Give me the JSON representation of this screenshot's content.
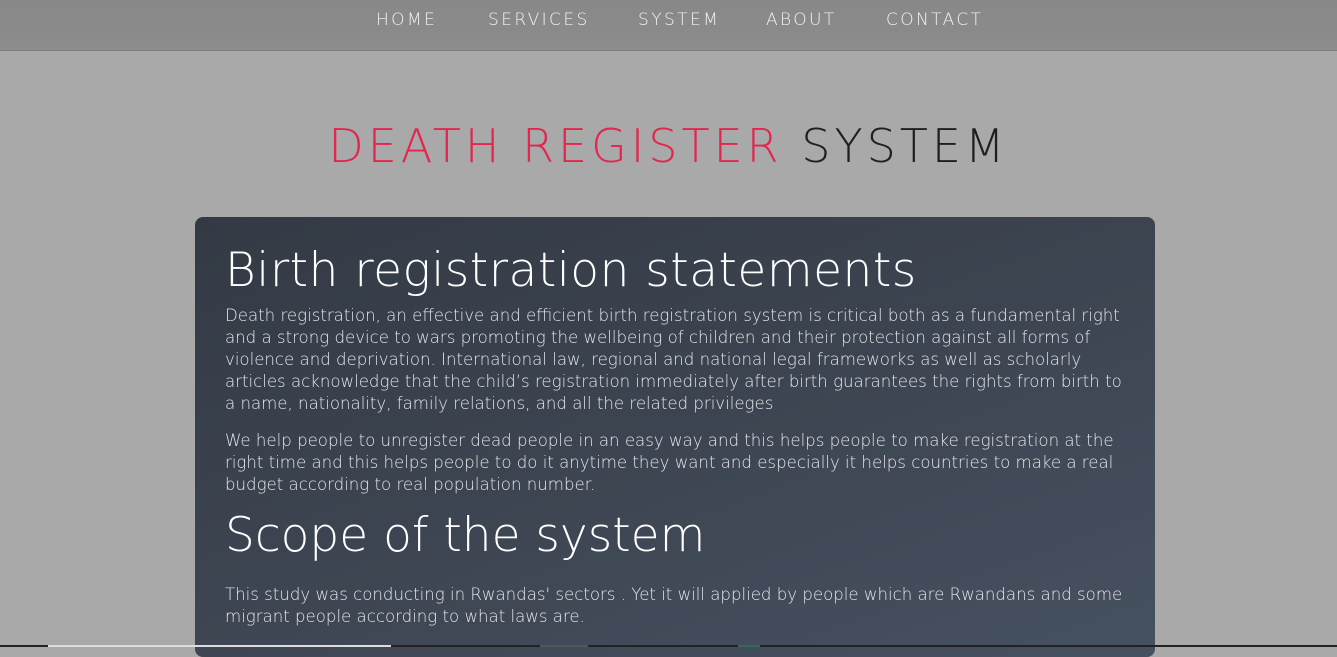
{
  "nav": {
    "items": [
      {
        "label": "HOME"
      },
      {
        "label": "SERVICES"
      },
      {
        "label": "SYSTEM"
      },
      {
        "label": "ABOUT"
      },
      {
        "label": "CONTACT"
      }
    ]
  },
  "header": {
    "title_part1": "DEATH REGISTER",
    "title_part2": "SYSTEM"
  },
  "main": {
    "heading1": "Birth registration statements",
    "paragraph1": "Death registration, an effective and efficient birth registration system is critical both as a fundamental right and a strong device to wars promoting the wellbeing of children and their protection against all forms of violence and deprivation. International law, regional and national legal frameworks as well as scholarly articles acknowledge that the child’s registration immediately after birth guarantees the rights from birth to a name, nationality, family relations, and all the related privileges",
    "paragraph2": "We help people to unregister dead people in an easy way and this helps people to make registration at the right time and this helps people to do it anytime they want and especially it helps countries to make a real budget according to real population number.",
    "heading2": "Scope of the system",
    "paragraph3": "This study was conducting in Rwandas' sectors . Yet it will applied by people which are Rwandans and some migrant people according to what laws are."
  },
  "colors": {
    "title_accent": "#e2264d",
    "title_dark": "#1f1f1f",
    "page_background": "#a9a9a9",
    "card_background": "#3e4653"
  }
}
